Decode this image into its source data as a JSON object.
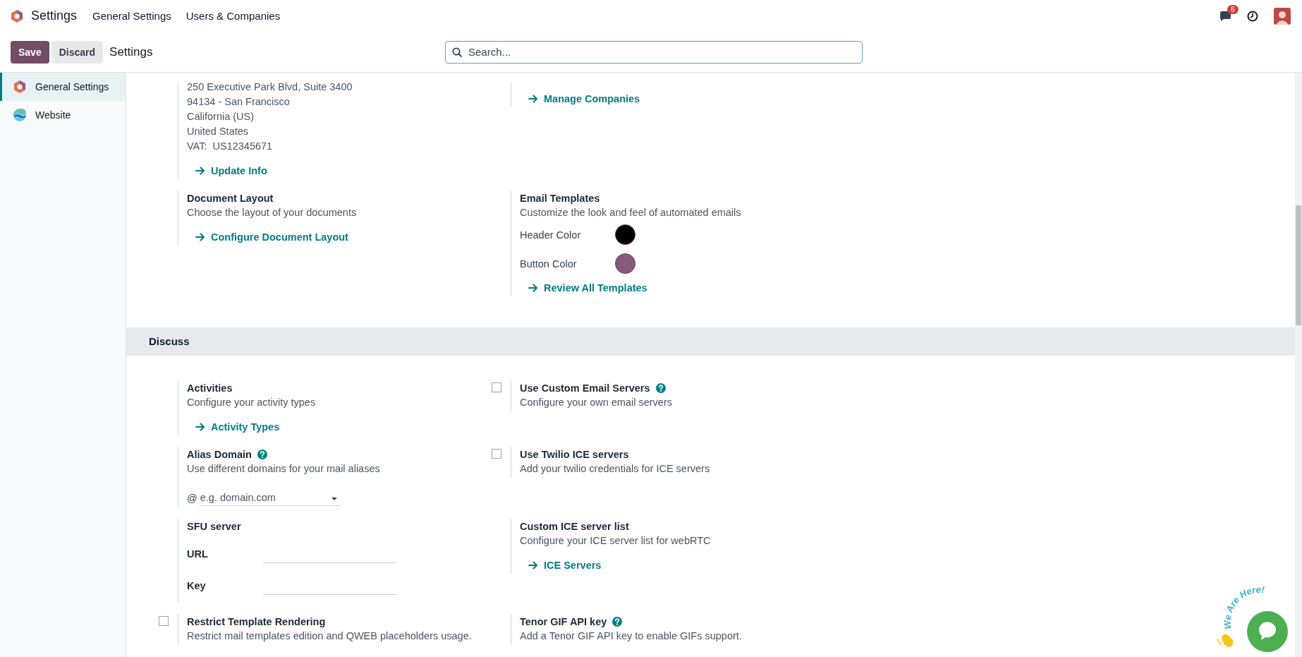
{
  "navbar": {
    "app_title": "Settings",
    "menu": [
      {
        "label": "General Settings"
      },
      {
        "label": "Users & Companies"
      }
    ],
    "message_count": "6"
  },
  "control_panel": {
    "buttons": [
      {
        "label": "Save",
        "kind": "primary"
      },
      {
        "label": "Discard",
        "kind": "secondary"
      }
    ],
    "breadcrumb": "Settings",
    "search": {
      "placeholder": "Search..."
    }
  },
  "sidebar": {
    "items": [
      {
        "label": "General Settings",
        "selected": true,
        "kind": "general"
      },
      {
        "label": "Website",
        "selected": false,
        "kind": "website"
      }
    ]
  },
  "sections": [
    {
      "settings": [
        {
          "address_lines": [
            "250 Executive Park Blvd, Suite 3400",
            "94134 - San Francisco",
            "California (US)",
            "United States",
            "VAT:  US12345671"
          ],
          "links": [
            "Update Info"
          ]
        },
        {
          "links": [
            "Manage Companies"
          ]
        },
        {
          "title": "Document Layout",
          "description": "Choose the layout of your documents",
          "links": [
            "Configure Document Layout"
          ]
        },
        {
          "title": "Email Templates",
          "description": "Customize the look and feel of automated emails",
          "colors": [
            {
              "label": "Header Color",
              "color": "#000000"
            },
            {
              "label": "Button Color",
              "color": "#875a7b"
            }
          ],
          "links": [
            "Review All Templates"
          ]
        }
      ]
    },
    {
      "title": "Discuss",
      "settings": [
        {
          "title": "Activities",
          "description": "Configure your activity types",
          "links": [
            "Activity Types"
          ]
        },
        {
          "checkbox": {
            "checked": false
          },
          "title": "Use Custom Email Servers",
          "help": true,
          "description": "Configure your own email servers"
        },
        {
          "title": "Alias Domain",
          "help": true,
          "description": "Use different domains for your mail aliases",
          "domain_field": {
            "prefix": "@",
            "placeholder": "e.g. domain.com"
          }
        },
        {
          "checkbox": {
            "checked": false
          },
          "title": "Use Twilio ICE servers",
          "description": "Add your twilio credentials for ICE servers"
        },
        {
          "title": "SFU server",
          "inputs": [
            {
              "label": "URL"
            },
            {
              "label": "Key"
            }
          ]
        },
        {
          "title": "Custom ICE server list",
          "description": "Configure your ICE server list for webRTC",
          "links": [
            "ICE Servers"
          ]
        },
        {
          "checkbox": {
            "checked": false
          },
          "title": "Restrict Template Rendering",
          "description": "Restrict mail templates edition and QWEB placeholders usage."
        },
        {
          "title": "Tenor GIF API key",
          "help": true,
          "description": "Add a Tenor GIF API key to enable GIFs support."
        }
      ]
    }
  ],
  "chat_widget": {
    "caption": "We Are Here!"
  }
}
